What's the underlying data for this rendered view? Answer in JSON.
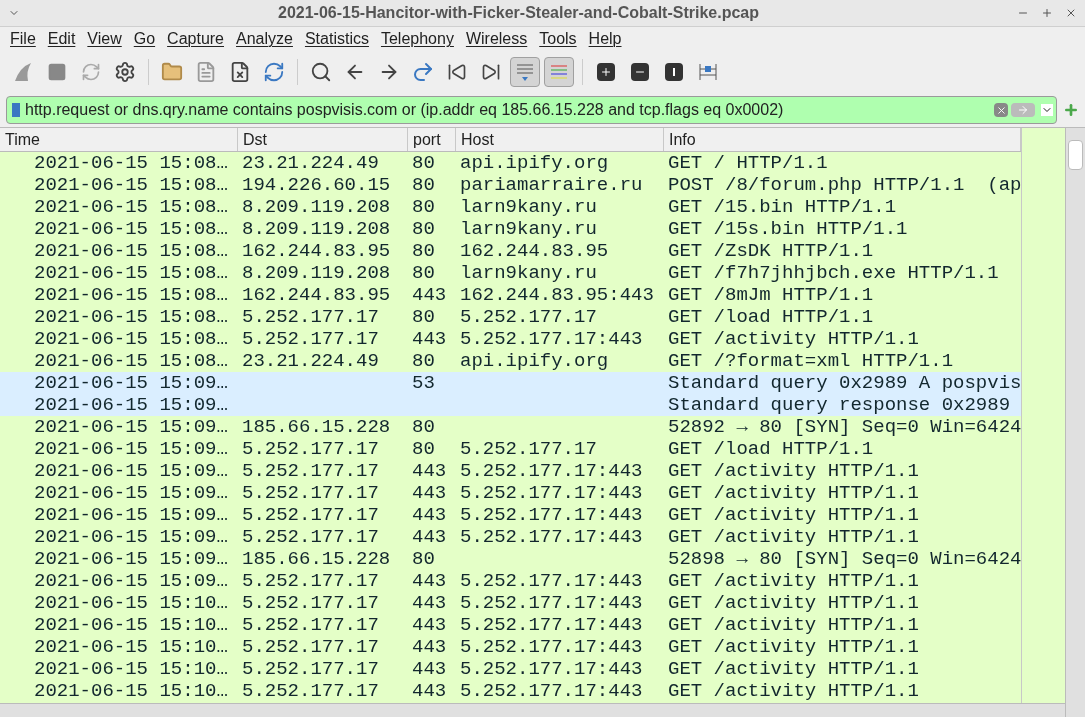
{
  "window": {
    "title": "2021-06-15-Hancitor-with-Ficker-Stealer-and-Cobalt-Strike.pcap"
  },
  "menu": [
    "File",
    "Edit",
    "View",
    "Go",
    "Capture",
    "Analyze",
    "Statistics",
    "Telephony",
    "Wireless",
    "Tools",
    "Help"
  ],
  "filter": {
    "value": "http.request or dns.qry.name contains pospvisis.com or (ip.addr eq 185.66.15.228 and tcp.flags eq 0x0002)"
  },
  "table": {
    "columns": [
      "Time",
      "Dst",
      "port",
      "Host",
      "Info"
    ],
    "rows": [
      {
        "cells": [
          "2021-06-15 15:08…",
          "23.21.224.49",
          "80",
          "api.ipify.org",
          "GET / HTTP/1.1"
        ],
        "color": "#e4ffc7"
      },
      {
        "cells": [
          "2021-06-15 15:08…",
          "194.226.60.15",
          "80",
          "pariamarraire.ru",
          "POST /8/forum.php HTTP/1.1  (ap"
        ],
        "color": "#e4ffc7"
      },
      {
        "cells": [
          "2021-06-15 15:08…",
          "8.209.119.208",
          "80",
          "larn9kany.ru",
          "GET /15.bin HTTP/1.1"
        ],
        "color": "#e4ffc7"
      },
      {
        "cells": [
          "2021-06-15 15:08…",
          "8.209.119.208",
          "80",
          "larn9kany.ru",
          "GET /15s.bin HTTP/1.1"
        ],
        "color": "#e4ffc7"
      },
      {
        "cells": [
          "2021-06-15 15:08…",
          "162.244.83.95",
          "80",
          "162.244.83.95",
          "GET /ZsDK HTTP/1.1"
        ],
        "color": "#e4ffc7"
      },
      {
        "cells": [
          "2021-06-15 15:08…",
          "8.209.119.208",
          "80",
          "larn9kany.ru",
          "GET /f7h7jhhjbch.exe HTTP/1.1"
        ],
        "color": "#e4ffc7"
      },
      {
        "cells": [
          "2021-06-15 15:08…",
          "162.244.83.95",
          "443",
          "162.244.83.95:443",
          "GET /8mJm HTTP/1.1"
        ],
        "color": "#e4ffc7"
      },
      {
        "cells": [
          "2021-06-15 15:08…",
          "5.252.177.17",
          "80",
          "5.252.177.17",
          "GET /load HTTP/1.1"
        ],
        "color": "#e4ffc7"
      },
      {
        "cells": [
          "2021-06-15 15:08…",
          "5.252.177.17",
          "443",
          "5.252.177.17:443",
          "GET /activity HTTP/1.1"
        ],
        "color": "#e4ffc7"
      },
      {
        "cells": [
          "2021-06-15 15:08…",
          "23.21.224.49",
          "80",
          "api.ipify.org",
          "GET /?format=xml HTTP/1.1"
        ],
        "color": "#e4ffc7"
      },
      {
        "cells": [
          "2021-06-15 15:09…",
          "",
          "53",
          "",
          "Standard query 0x2989 A pospvis"
        ],
        "color": "#daeeff"
      },
      {
        "cells": [
          "2021-06-15 15:09…",
          "",
          "",
          "",
          "Standard query response 0x2989"
        ],
        "color": "#daeeff"
      },
      {
        "cells": [
          "2021-06-15 15:09…",
          "185.66.15.228",
          "80",
          "",
          "52892 → 80 [SYN] Seq=0 Win=6424"
        ],
        "color": "#e4ffc7"
      },
      {
        "cells": [
          "2021-06-15 15:09…",
          "5.252.177.17",
          "80",
          "5.252.177.17",
          "GET /load HTTP/1.1"
        ],
        "color": "#e4ffc7"
      },
      {
        "cells": [
          "2021-06-15 15:09…",
          "5.252.177.17",
          "443",
          "5.252.177.17:443",
          "GET /activity HTTP/1.1"
        ],
        "color": "#e4ffc7"
      },
      {
        "cells": [
          "2021-06-15 15:09…",
          "5.252.177.17",
          "443",
          "5.252.177.17:443",
          "GET /activity HTTP/1.1"
        ],
        "color": "#e4ffc7"
      },
      {
        "cells": [
          "2021-06-15 15:09…",
          "5.252.177.17",
          "443",
          "5.252.177.17:443",
          "GET /activity HTTP/1.1"
        ],
        "color": "#e4ffc7"
      },
      {
        "cells": [
          "2021-06-15 15:09…",
          "5.252.177.17",
          "443",
          "5.252.177.17:443",
          "GET /activity HTTP/1.1"
        ],
        "color": "#e4ffc7"
      },
      {
        "cells": [
          "2021-06-15 15:09…",
          "185.66.15.228",
          "80",
          "",
          "52898 → 80 [SYN] Seq=0 Win=6424"
        ],
        "color": "#e4ffc7"
      },
      {
        "cells": [
          "2021-06-15 15:09…",
          "5.252.177.17",
          "443",
          "5.252.177.17:443",
          "GET /activity HTTP/1.1"
        ],
        "color": "#e4ffc7"
      },
      {
        "cells": [
          "2021-06-15 15:10…",
          "5.252.177.17",
          "443",
          "5.252.177.17:443",
          "GET /activity HTTP/1.1"
        ],
        "color": "#e4ffc7"
      },
      {
        "cells": [
          "2021-06-15 15:10…",
          "5.252.177.17",
          "443",
          "5.252.177.17:443",
          "GET /activity HTTP/1.1"
        ],
        "color": "#e4ffc7"
      },
      {
        "cells": [
          "2021-06-15 15:10…",
          "5.252.177.17",
          "443",
          "5.252.177.17:443",
          "GET /activity HTTP/1.1"
        ],
        "color": "#e4ffc7"
      },
      {
        "cells": [
          "2021-06-15 15:10…",
          "5.252.177.17",
          "443",
          "5.252.177.17:443",
          "GET /activity HTTP/1.1"
        ],
        "color": "#e4ffc7"
      },
      {
        "cells": [
          "2021-06-15 15:10…",
          "5.252.177.17",
          "443",
          "5.252.177.17:443",
          "GET /activity HTTP/1.1"
        ],
        "color": "#e4ffc7"
      }
    ]
  }
}
